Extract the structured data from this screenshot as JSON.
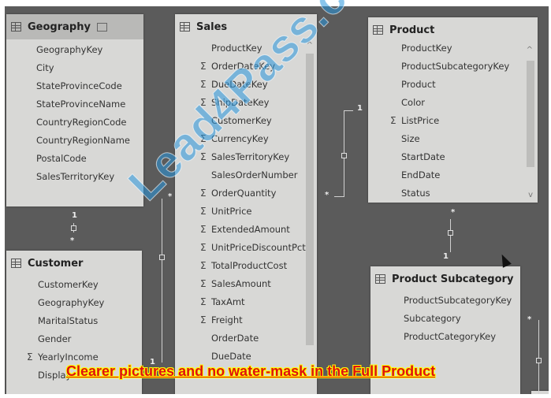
{
  "tables": {
    "geography": {
      "title": "Geography",
      "fields": [
        {
          "name": "GeographyKey",
          "sum": false
        },
        {
          "name": "City",
          "sum": false
        },
        {
          "name": "StateProvinceCode",
          "sum": false
        },
        {
          "name": "StateProvinceName",
          "sum": false
        },
        {
          "name": "CountryRegionCode",
          "sum": false
        },
        {
          "name": "CountryRegionName",
          "sum": false
        },
        {
          "name": "PostalCode",
          "sum": false
        },
        {
          "name": "SalesTerritoryKey",
          "sum": false
        }
      ]
    },
    "sales": {
      "title": "Sales",
      "fields": [
        {
          "name": "ProductKey",
          "sum": false
        },
        {
          "name": "OrderDateKey",
          "sum": true
        },
        {
          "name": "DueDateKey",
          "sum": true
        },
        {
          "name": "ShipDateKey",
          "sum": true
        },
        {
          "name": "CustomerKey",
          "sum": false
        },
        {
          "name": "CurrencyKey",
          "sum": true
        },
        {
          "name": "SalesTerritoryKey",
          "sum": true
        },
        {
          "name": "SalesOrderNumber",
          "sum": false
        },
        {
          "name": "OrderQuantity",
          "sum": true
        },
        {
          "name": "UnitPrice",
          "sum": true
        },
        {
          "name": "ExtendedAmount",
          "sum": true
        },
        {
          "name": "UnitPriceDiscountPct",
          "sum": true
        },
        {
          "name": "TotalProductCost",
          "sum": true
        },
        {
          "name": "SalesAmount",
          "sum": true
        },
        {
          "name": "TaxAmt",
          "sum": true
        },
        {
          "name": "Freight",
          "sum": true
        },
        {
          "name": "OrderDate",
          "sum": false
        },
        {
          "name": "DueDate",
          "sum": false
        }
      ]
    },
    "product": {
      "title": "Product",
      "fields": [
        {
          "name": "ProductKey",
          "sum": false
        },
        {
          "name": "ProductSubcategoryKey",
          "sum": false
        },
        {
          "name": "Product",
          "sum": false
        },
        {
          "name": "Color",
          "sum": false
        },
        {
          "name": "ListPrice",
          "sum": true
        },
        {
          "name": "Size",
          "sum": false
        },
        {
          "name": "StartDate",
          "sum": false
        },
        {
          "name": "EndDate",
          "sum": false
        },
        {
          "name": "Status",
          "sum": false
        }
      ]
    },
    "customer": {
      "title": "Customer",
      "fields": [
        {
          "name": "CustomerKey",
          "sum": false
        },
        {
          "name": "GeographyKey",
          "sum": false
        },
        {
          "name": "MaritalStatus",
          "sum": false
        },
        {
          "name": "Gender",
          "sum": false
        },
        {
          "name": "YearlyIncome",
          "sum": true
        },
        {
          "name": "Display",
          "sum": false
        }
      ]
    },
    "product_subcategory": {
      "title": "Product Subcategory",
      "fields": [
        {
          "name": "ProductSubcategoryKey",
          "sum": false
        },
        {
          "name": "Subcategory",
          "sum": false
        },
        {
          "name": "ProductCategoryKey",
          "sum": false
        }
      ]
    }
  },
  "relationships": {
    "one": "1",
    "many": "*"
  },
  "sigma_symbol": "Σ",
  "scroll_up": "^",
  "scroll_down": "v",
  "watermark": "Lead4Pass.com",
  "banner": "Clearer pictures and no water-mask in the Full Product"
}
